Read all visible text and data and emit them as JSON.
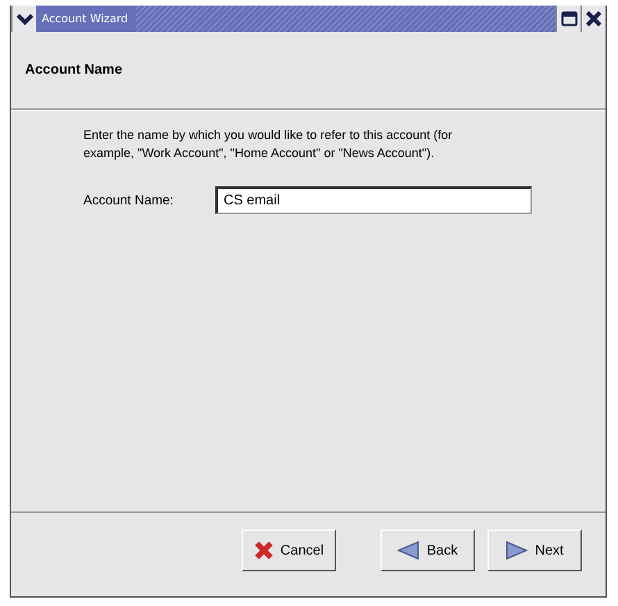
{
  "window": {
    "title": "Account Wizard"
  },
  "header": {
    "title": "Account Name"
  },
  "description": "Enter the name by which you would like to refer to this account (for example, \"Work Account\", \"Home Account\" or \"News Account\").",
  "field": {
    "label": "Account Name:",
    "value": "CS email"
  },
  "buttons": [
    {
      "label": "Cancel",
      "kind": "cancel"
    },
    {
      "label": "Back",
      "kind": "back"
    },
    {
      "label": "Next",
      "kind": "next"
    }
  ]
}
